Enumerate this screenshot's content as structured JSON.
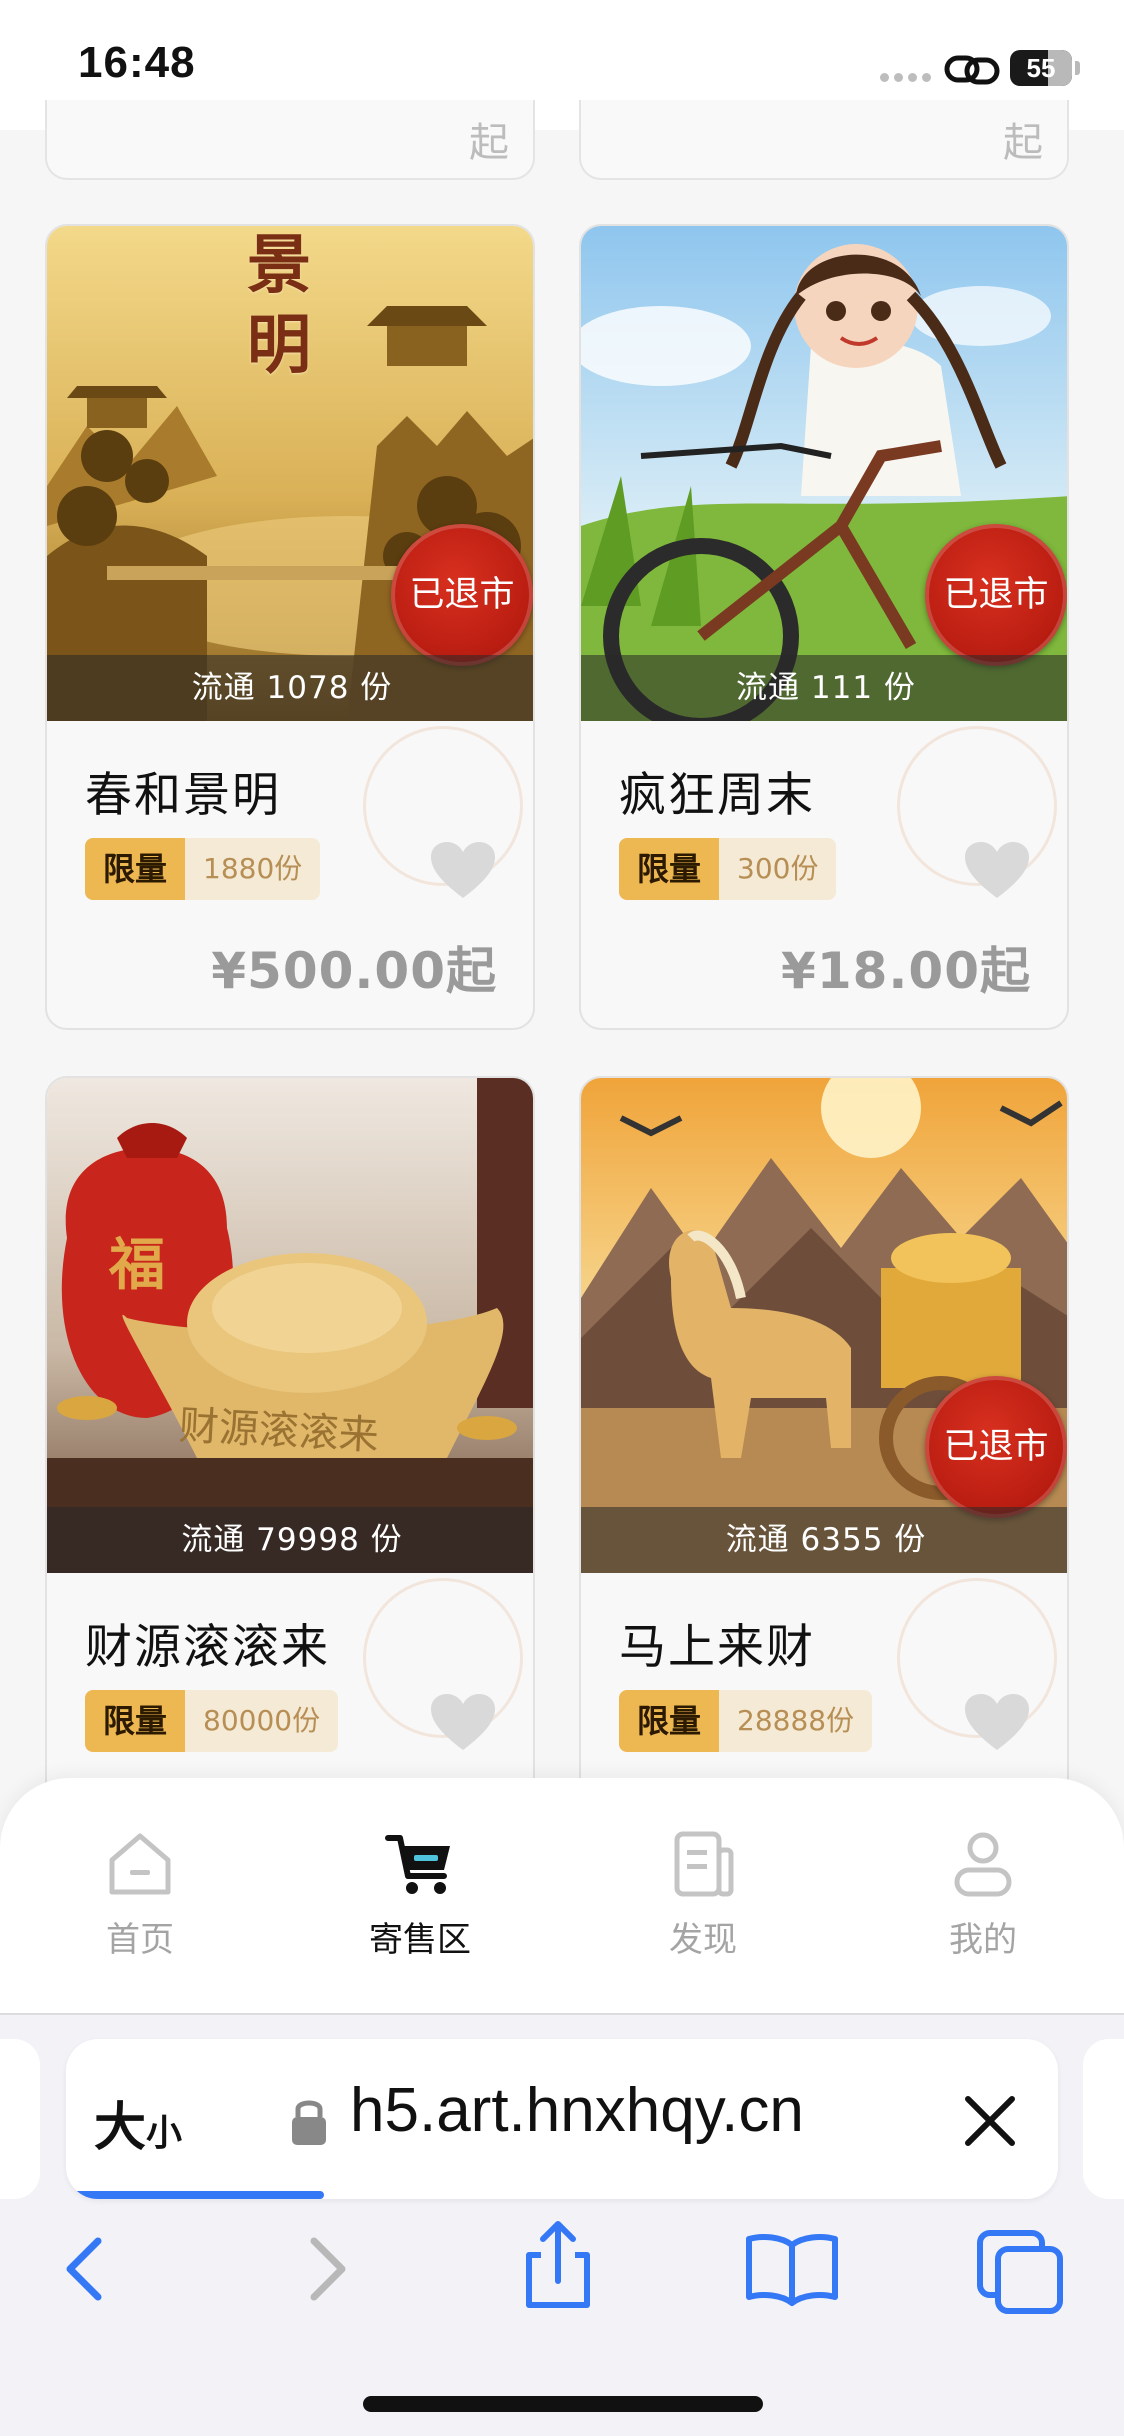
{
  "status_bar": {
    "time": "16:48",
    "battery": "55"
  },
  "top_peek": {
    "left_text": "起",
    "right_text": "起"
  },
  "cards": [
    {
      "title": "春和景明",
      "circulation": "流通 1078 份",
      "limit_label": "限量",
      "limit_count": "1880份",
      "price": "¥500.00起",
      "badge": "已退市"
    },
    {
      "title": "疯狂周末",
      "circulation": "流通 111 份",
      "limit_label": "限量",
      "limit_count": "300份",
      "price": "¥18.00起",
      "badge": "已退市"
    },
    {
      "title": "财源滚滚来",
      "circulation": "流通 79998 份",
      "limit_label": "限量",
      "limit_count": "80000份",
      "price": "",
      "badge": ""
    },
    {
      "title": "马上来财",
      "circulation": "流通 6355 份",
      "limit_label": "限量",
      "limit_count": "28888份",
      "price": "",
      "badge": "已退市"
    }
  ],
  "artwork_text": {
    "card0": [
      "景",
      "明"
    ],
    "card2": [
      "福",
      "财源滚滚来"
    ]
  },
  "tabs": [
    {
      "label": "首页",
      "icon": "home-icon",
      "active": false
    },
    {
      "label": "寄售区",
      "icon": "cart-icon",
      "active": true
    },
    {
      "label": "发现",
      "icon": "document-icon",
      "active": false
    },
    {
      "label": "我的",
      "icon": "person-icon",
      "active": false
    }
  ],
  "browser": {
    "text_size_big": "大",
    "text_size_small": "小",
    "url": "h5.art.hnxhqy.cn",
    "load_progress": 0.26
  },
  "colors": {
    "accent_gold": "#edb752",
    "badge_red": "#c8231a",
    "browser_blue": "#3478f6"
  }
}
